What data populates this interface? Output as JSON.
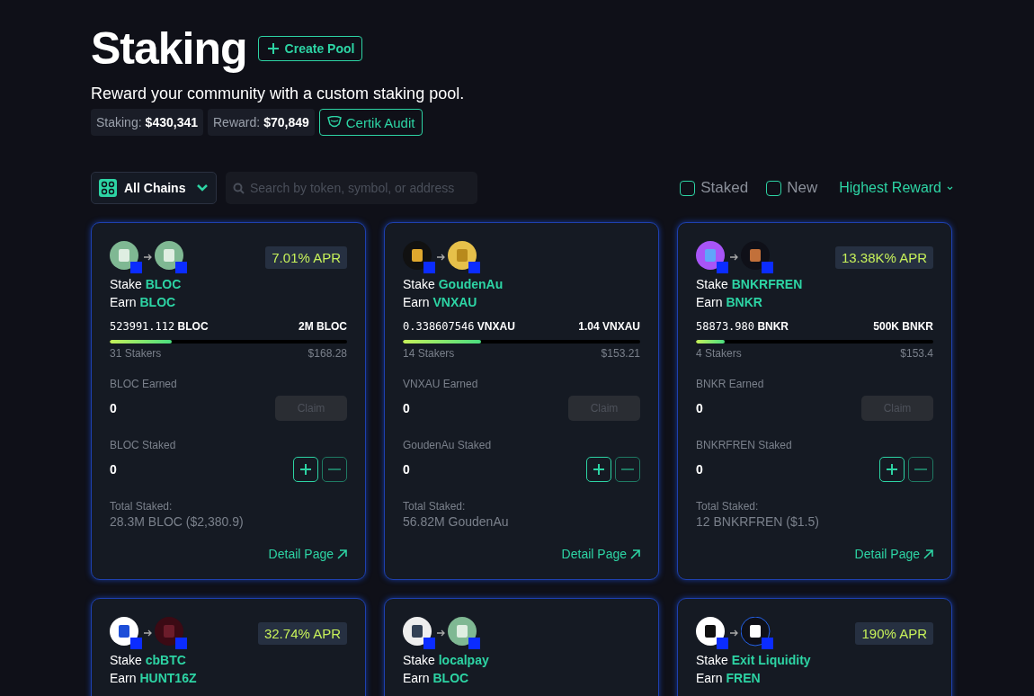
{
  "header": {
    "title": "Staking",
    "create_button": "Create Pool",
    "subtitle": "Reward your community with a custom staking pool.",
    "stats": [
      {
        "label": "Staking:",
        "value": "$430,341"
      },
      {
        "label": "Reward:",
        "value": "$70,849"
      }
    ],
    "audit_button": "Certik Audit"
  },
  "filters": {
    "chain_select": "All Chains",
    "search": {
      "placeholder": "Search by token, symbol, or address"
    },
    "checkboxes": [
      {
        "label": "Staked",
        "checked": false
      },
      {
        "label": "New",
        "checked": false
      }
    ],
    "sort": "Highest Reward"
  },
  "pools": [
    {
      "logos": [
        {
          "kind": "bloc"
        },
        {
          "kind": "bloc"
        }
      ],
      "apr": "7.01% APR",
      "stake_label": "Stake",
      "stake_token": "BLOC",
      "earn_label": "Earn",
      "earn_token": "BLOC",
      "progress": {
        "current": "523991.112",
        "current_unit": "BLOC",
        "max": "2M BLOC",
        "level": 0.26,
        "stakers": "31 Stakers",
        "usd": "$168.28"
      },
      "earned": {
        "label": "BLOC Earned",
        "value": "0",
        "claim": "Claim",
        "disabled": true
      },
      "staked": {
        "label": "BLOC Staked",
        "value": "0"
      },
      "total": {
        "label": "Total Staked:",
        "value": "28.3M BLOC ($2,380.9)"
      },
      "detail": "Detail Page"
    },
    {
      "logos": [
        {
          "kind": "gouden"
        },
        {
          "kind": "vnxau"
        }
      ],
      "stake_label": "Stake",
      "stake_token": "GoudenAu",
      "earn_label": "Earn",
      "earn_token": "VNXAU",
      "progress": {
        "current": "0.338607546",
        "current_unit": "VNXAU",
        "max": "1.04 VNXAU",
        "level": 0.33,
        "stakers": "14 Stakers",
        "usd": "$153.21"
      },
      "earned": {
        "label": "VNXAU Earned",
        "value": "0",
        "claim": "Claim",
        "disabled": true
      },
      "staked": {
        "label": "GoudenAu Staked",
        "value": "0"
      },
      "total": {
        "label": "Total Staked:",
        "value": "56.82M GoudenAu"
      },
      "detail": "Detail Page"
    },
    {
      "logos": [
        {
          "kind": "bnkrfren"
        },
        {
          "kind": "bnkr"
        }
      ],
      "apr": "13.38K% APR",
      "stake_label": "Stake",
      "stake_token": "BNKRFREN",
      "earn_label": "Earn",
      "earn_token": "BNKR",
      "progress": {
        "current": "58873.980",
        "current_unit": "BNKR",
        "max": "500K BNKR",
        "level": 0.12,
        "stakers": "4 Stakers",
        "usd": "$153.4"
      },
      "earned": {
        "label": "BNKR Earned",
        "value": "0",
        "claim": "Claim",
        "disabled": true
      },
      "staked": {
        "label": "BNKRFREN Staked",
        "value": "0"
      },
      "total": {
        "label": "Total Staked:",
        "value": "12 BNKRFREN ($1.5)"
      },
      "detail": "Detail Page"
    },
    {
      "logos": [
        {
          "kind": "cbbtc"
        },
        {
          "kind": "hunt"
        }
      ],
      "apr": "32.74% APR",
      "stake_label": "Stake",
      "stake_token": "cbBTC",
      "earn_label": "Earn",
      "earn_token": "HUNT16Z"
    },
    {
      "logos": [
        {
          "kind": "localpay"
        },
        {
          "kind": "bloc"
        }
      ],
      "stake_label": "Stake",
      "stake_token": "localpay",
      "earn_label": "Earn",
      "earn_token": "BLOC"
    },
    {
      "logos": [
        {
          "kind": "exit"
        },
        {
          "kind": "fren"
        }
      ],
      "apr": "190% APR",
      "stake_label": "Stake",
      "stake_token": "Exit Liquidity",
      "earn_label": "Earn",
      "earn_token": "FREN"
    }
  ]
}
